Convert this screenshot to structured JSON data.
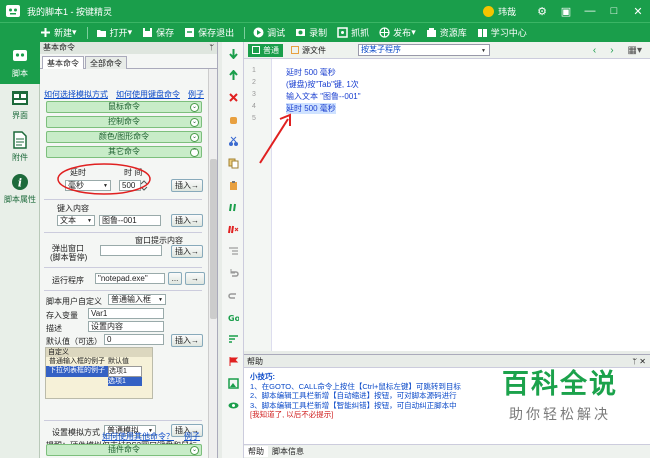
{
  "window": {
    "title": "我的脚本1 - 按键精灵",
    "user_name": "玮哉"
  },
  "toolbar": {
    "items": [
      "新建",
      "打开",
      "保存",
      "保存退出",
      "调试",
      "录制",
      "抓抓",
      "发布",
      "资源库",
      "学习中心"
    ]
  },
  "rail": {
    "items": [
      "脚本",
      "界面",
      "附件",
      "脚本属性"
    ]
  },
  "panel": {
    "header": "基本命令",
    "pin": "ᛘ",
    "tabs": [
      "基本命令",
      "全部命令"
    ],
    "links_top": [
      "如何选择模拟方式",
      "如何使用键盘命令",
      "例子"
    ],
    "sections": [
      "鼠标命令",
      "控制命令",
      "颜色/图形命令",
      "其它命令"
    ],
    "delay": {
      "label_delay": "延时",
      "label_time": "时 间",
      "unit": "毫秒",
      "value": "500"
    },
    "key_input": {
      "label": "键入内容",
      "mode": "文本",
      "value": "图鲁--001"
    },
    "popup": {
      "label1": "弹出窗口",
      "label2": "(脚本暂停)",
      "hint": "窗口提示内容"
    },
    "run": {
      "label": "运行程序",
      "value": "\"notepad.exe\"",
      "browse": "..."
    },
    "custom": {
      "label": "脚本用户自定义",
      "mode": "普通输入框",
      "var_label": "存入变量",
      "var_value": "Var1",
      "desc_label": "描述",
      "desc_value": "设置内容",
      "default_label": "默认值（可选）",
      "default_value": "0",
      "preview_title": "自定义",
      "preview_row1_a": "普通输入框的例子",
      "preview_row1_b": "默认值",
      "preview_row2_a": "下拉列表框的例子",
      "preview_row2_b": "选项1",
      "preview_row3_b": "选项1"
    },
    "simulate": {
      "label": "设置模拟方式",
      "mode": "普通模拟",
      "note": "提醒：硬件模拟仅支持PS2圆口键盘和鼠标"
    },
    "links_bottom": [
      "如何使用其他命令？",
      "例子"
    ],
    "plugin": "插件命令",
    "insert_label": "插入"
  },
  "editor": {
    "tabs": [
      "普通",
      "源文件"
    ],
    "dropdown": "按某子程序",
    "nav_prev": "‹",
    "nav_next": "›",
    "lines": [
      {
        "n": "1",
        "text": "延时 500 毫秒"
      },
      {
        "n": "2",
        "text": "(键盘)按\"Tab\"键, 1次"
      },
      {
        "n": "3",
        "text": "输入文本 \"图鲁--001\""
      },
      {
        "n": "4",
        "text": "延时 500 毫秒"
      },
      {
        "n": "5",
        "text": ""
      }
    ]
  },
  "help": {
    "header": "帮助",
    "tips_title": "小技巧:",
    "tips": [
      "1、在GOTO、CALL命令上按住【Ctrl+鼠标左键】可跳转到目标",
      "2、脚本编辑工具栏新增【自动缩进】按钮，可对脚本源码进行",
      "3、脚本编辑工具栏新增【智能纠错】按钮，可自动纠正脚本中"
    ],
    "dismiss": "[我知道了, 以后不必提示]",
    "tabs": [
      "帮助",
      "脚本信息"
    ]
  },
  "watermark": {
    "title": "百科全说",
    "subtitle": "助你轻松解决"
  },
  "colors": {
    "brand": "#1a9e4b",
    "code": "#1a3fd0",
    "annotation": "#e02020"
  }
}
